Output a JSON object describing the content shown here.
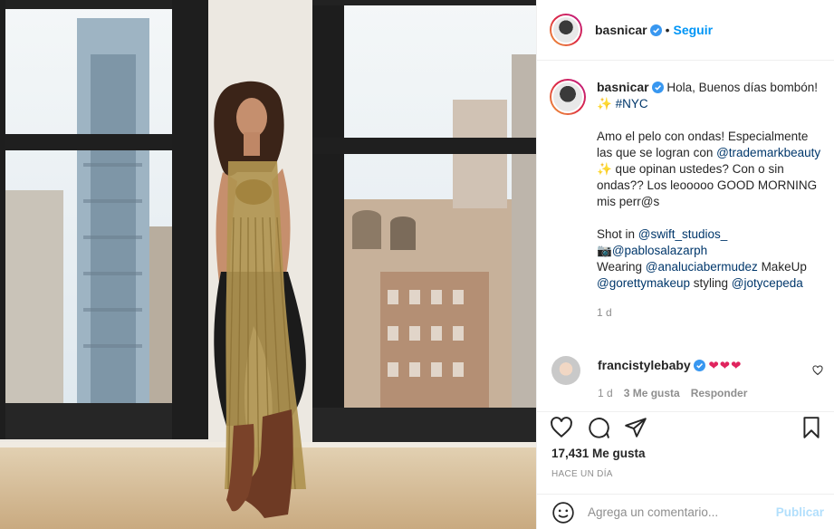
{
  "post": {
    "username": "basnicar",
    "follow_label": "Seguir",
    "dot": "•"
  },
  "caption": {
    "username": "basnicar",
    "line1": "Hola, Buenos días bombón! ✨",
    "hashtag": "#NYC",
    "p2_text1": "Amo el pelo con ondas! Especialmente las que se logran con ",
    "p2_link": "@trademarkbeauty",
    "p2_text2": " ✨ que opinan ustedes? Con o sin ondas?? Los leooooo GOOD MORNING mis perr@s",
    "shot_text": "Shot in ",
    "shot_link": "@swift_studios_",
    "camera": "📷",
    "photo_link": "@pablosalazarph",
    "wearing_text": "Wearing ",
    "wearing_link": "@analuciabermudez",
    "makeup_text": " MakeUp",
    "makeup_link": "@gorettymakeup",
    "styling_text": " styling ",
    "styling_link": "@jotycepeda",
    "age": "1 d"
  },
  "comment": {
    "username": "francistylebaby",
    "text": "❤❤❤",
    "age": "1 d",
    "likes": "3 Me gusta",
    "reply": "Responder"
  },
  "stats": {
    "likes": "17,431 Me gusta",
    "time": "HACE UN DÍA"
  },
  "composer": {
    "placeholder": "Agrega un comentario...",
    "publish": "Publicar"
  },
  "colors": {
    "link": "#00376b",
    "follow": "#0095f6",
    "verified": "#3897f0",
    "publish_disabled": "#b2dffc"
  }
}
